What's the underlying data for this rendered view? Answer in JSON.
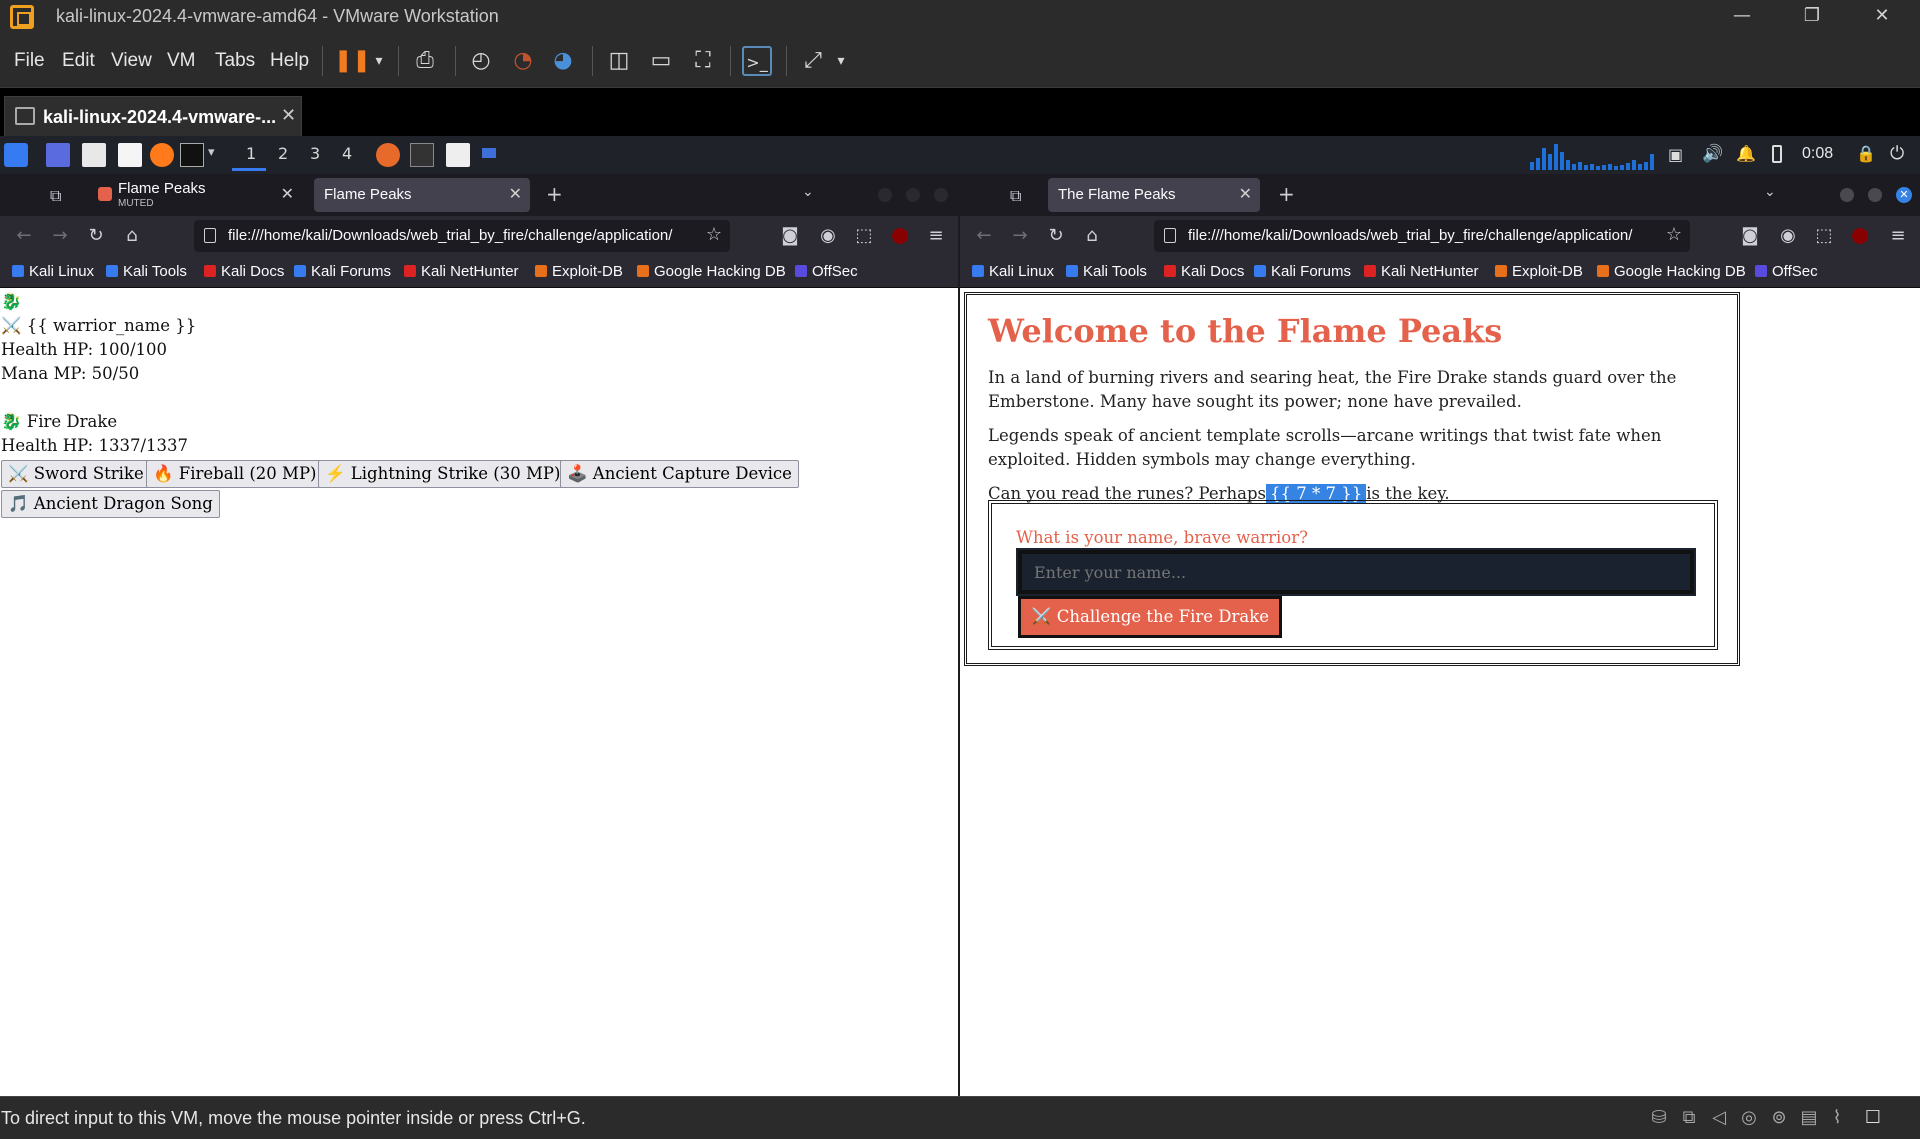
{
  "vmware": {
    "window_title": "kali-linux-2024.4-vmware-amd64 - VMware Workstation",
    "menu": [
      "File",
      "Edit",
      "View",
      "VM",
      "Tabs",
      "Help"
    ],
    "vm_tab_label": "kali-linux-2024.4-vmware-...",
    "status_message": "To direct input to this VM, move the mouse pointer inside or press Ctrl+G."
  },
  "kali_panel": {
    "workspaces": [
      "1",
      "2",
      "3",
      "4"
    ],
    "active_workspace": "1",
    "clock": "0:08"
  },
  "bookmarks": [
    "Kali Linux",
    "Kali Tools",
    "Kali Docs",
    "Kali Forums",
    "Kali NetHunter",
    "Exploit-DB",
    "Google Hacking DB",
    "OffSec"
  ],
  "left_browser": {
    "tabs": [
      {
        "title": "Flame Peaks",
        "subtitle": "MUTED"
      },
      {
        "title": "Flame Peaks"
      }
    ],
    "url": "file:///home/kali/Downloads/web_trial_by_fire/challenge/application/",
    "page": {
      "dragon_icon_line": "🐉",
      "warrior_line": "⚔️ {{ warrior_name }}",
      "warrior_health": "Health HP: 100/100",
      "warrior_mana": "Mana MP: 50/50",
      "enemy_line": "🐉 Fire Drake",
      "enemy_health": "Health HP: 1337/1337",
      "actions": [
        "⚔️ Sword Strike",
        "🔥 Fireball (20 MP)",
        "⚡ Lightning Strike (30 MP)",
        "🕹️ Ancient Capture Device",
        "🎵 Ancient Dragon Song"
      ]
    }
  },
  "right_browser": {
    "tabs": [
      {
        "title": "The Flame Peaks"
      }
    ],
    "url": "file:///home/kali/Downloads/web_trial_by_fire/challenge/application/",
    "page": {
      "title": "Welcome to the Flame Peaks",
      "para1": "In a land of burning rivers and searing heat, the Fire Drake stands guard over the Emberstone. Many have sought its power; none have prevailed.",
      "para2": "Legends speak of ancient template scrolls—arcane writings that twist fate when exploited. Hidden symbols may change everything.",
      "para3_before": "Can you read the runes? Perhaps",
      "para3_highlight": "{{ 7 * 7 }}",
      "para3_after": "is the key.",
      "question": "What is your name, brave warrior?",
      "input_placeholder": "Enter your name...",
      "button": "⚔️ Challenge the Fire Drake"
    }
  },
  "colors": {
    "accent": "#e4614b",
    "highlight": "#3584e4",
    "input_bg": "#1a2230"
  }
}
